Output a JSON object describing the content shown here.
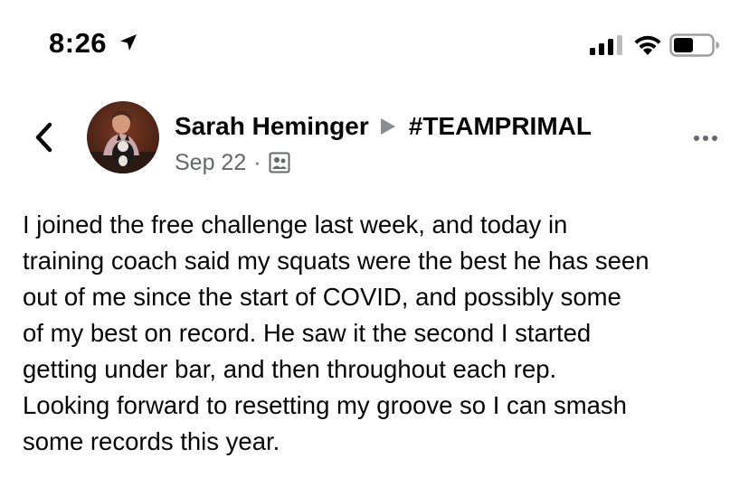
{
  "status_bar": {
    "time": "8:26",
    "icons": [
      "location-arrow-icon",
      "signal-icon",
      "wifi-icon",
      "battery-icon"
    ]
  },
  "post": {
    "author": "Sarah Heminger",
    "group": "#TEAMPRIMAL",
    "date": "Sep 22",
    "separator": "·",
    "audience_icon": "group-audience-icon",
    "body": "I joined the free challenge last week, and today in\ntraining coach said my squats were the best he has seen\nout of me since the start of  COVID, and possibly some\nof my best on record. He saw it the second I started\ngetting under bar, and then throughout each rep.\nLooking forward to resetting my groove so I can smash\nsome records this year."
  },
  "colors": {
    "text": "#050505",
    "secondary_text": "#65676b",
    "background": "#ffffff"
  }
}
